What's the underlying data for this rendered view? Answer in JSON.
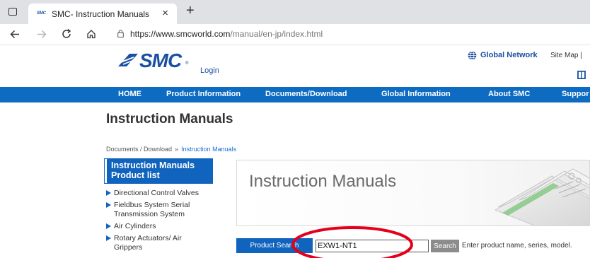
{
  "browser": {
    "tab_title": "SMC- Instruction Manuals",
    "favicon_text": "SMC",
    "close_glyph": "×",
    "new_tab_glyph": "+",
    "url_host": "https://www.smcworld.com",
    "url_path": "/manual/en-jp/index.html",
    "icons": [
      "window-icon",
      "back-icon",
      "forward-icon",
      "reload-icon",
      "home-icon",
      "lock-icon"
    ]
  },
  "header": {
    "logo_text": "SMC",
    "logo_mark": "®",
    "login": "Login",
    "global_network": "Global Network",
    "site_map": "Site Map |"
  },
  "nav": {
    "items": [
      "HOME",
      "Product Information",
      "Documents/Download",
      "Global Information",
      "About SMC",
      "Suppor"
    ]
  },
  "page": {
    "title": "Instruction Manuals",
    "breadcrumb": [
      "Documents / Download",
      "»",
      "Instruction Manuals"
    ]
  },
  "sidebar": {
    "heading_line1": "Instruction Manuals",
    "heading_line2": "Product list",
    "items": [
      "Directional Control Valves",
      "Fieldbus System Serial Transmission System",
      "Air Cylinders",
      "Rotary Actuators/ Air Grippers"
    ]
  },
  "banner": {
    "title": "Instruction Manuals"
  },
  "search": {
    "label": "Product Search",
    "value": "EXW1-NT1",
    "button": "Search",
    "hint": "Enter product name, series, model."
  },
  "colors": {
    "brand_blue": "#0d6cc2",
    "annotation_red": "#e3001b"
  }
}
